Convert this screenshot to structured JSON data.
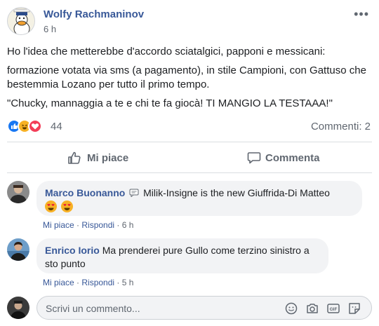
{
  "post": {
    "author": "Wolfy Rachmaninov",
    "time": "6 h",
    "more_label": "•••",
    "paragraphs": [
      "Ho l'idea che metterebbe d'accordo sciatalgici, papponi e messicani:",
      "formazione votata via sms (a pagamento), in stile Campioni, con Gattuso che bestemmia Lozano per tutto il primo tempo.",
      "\"Chucky, mannaggia a te e chi te fa giocà! TI MANGIO LA TESTAAA!\""
    ],
    "reactions": {
      "icons": [
        "like-icon",
        "haha-icon",
        "love-icon"
      ],
      "count": "44"
    },
    "comments_count": "Commenti: 2"
  },
  "actions": {
    "like_label": "Mi piace",
    "comment_label": "Commenta"
  },
  "comments": [
    {
      "name": "Marco Buonanno",
      "text": "Milik-Insigne is the new Giuffrida-Di Matteo",
      "badge_icon": "chat-bubble-icon",
      "emojis": [
        "heart-eyes-emoji",
        "heart-eyes-emoji"
      ],
      "like": "Mi piace",
      "reply": "Rispondi",
      "time": "6 h"
    },
    {
      "name": "Enrico Iorio",
      "text": "Ma prenderei pure Gullo come terzino sinistro a sto punto",
      "like": "Mi piace",
      "reply": "Rispondi",
      "time": "5 h"
    }
  ],
  "composer": {
    "placeholder": "Scrivi un commento...",
    "icons": [
      "emoji-icon",
      "camera-icon",
      "gif-icon",
      "sticker-icon"
    ]
  },
  "colors": {
    "link": "#385898",
    "secondary_text": "#606770",
    "like_blue": "#1877f2",
    "bubble_bg": "#f2f3f5"
  }
}
